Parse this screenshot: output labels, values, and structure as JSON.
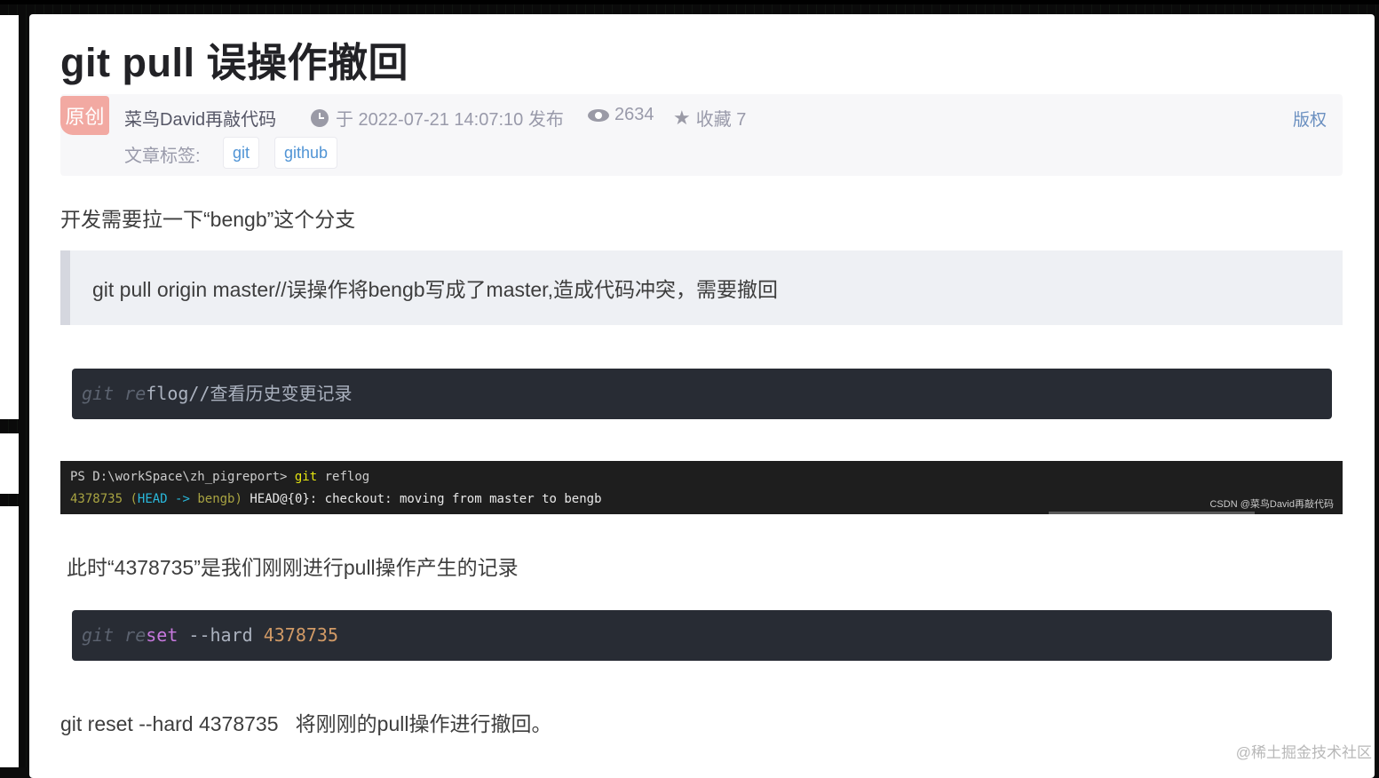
{
  "article": {
    "title": "git pull 误操作撤回",
    "badge": "原创",
    "author": "菜鸟David再敲代码",
    "published": "于 2022-07-21 14:07:10 发布",
    "views": "2634",
    "favorites": "收藏 7",
    "copyright": "版权",
    "tags_label": "文章标签:",
    "tags": [
      "git",
      "github"
    ]
  },
  "content": {
    "para1": "开发需要拉一下“bengb”这个分支",
    "quote": "git pull origin master//误操作将bengb写成了master,造成代码冲突，需要撤回",
    "code1": {
      "dim": "git re",
      "rest": "flog//",
      "comment": "查看历史变更记录"
    },
    "terminal": {
      "prompt": "PS D:\\workSpace\\zh_pigreport>",
      "cmd": "git",
      "arg": "reflog",
      "hash": "4378735",
      "ref_open": "(",
      "head": "HEAD",
      "arrow": "->",
      "branch": "bengb",
      "ref_close": ")",
      "entry": "HEAD@{0}: checkout: moving from master to bengb",
      "watermark": "CSDN @菜鸟David再敲代码"
    },
    "para2": "此时“4378735”是我们刚刚进行pull操作产生的记录",
    "code2": {
      "dim": "git re",
      "kw": "set",
      "flag": " --hard ",
      "num": "4378735"
    },
    "para3": "git reset --hard 4378735   将刚刚的pull操作进行撤回。"
  },
  "watermark": "@稀土掘金技术社区",
  "colors": {
    "code_bg": "#282c34",
    "tag_text": "#5094d5",
    "badge_bg": "#f2a9a2"
  }
}
